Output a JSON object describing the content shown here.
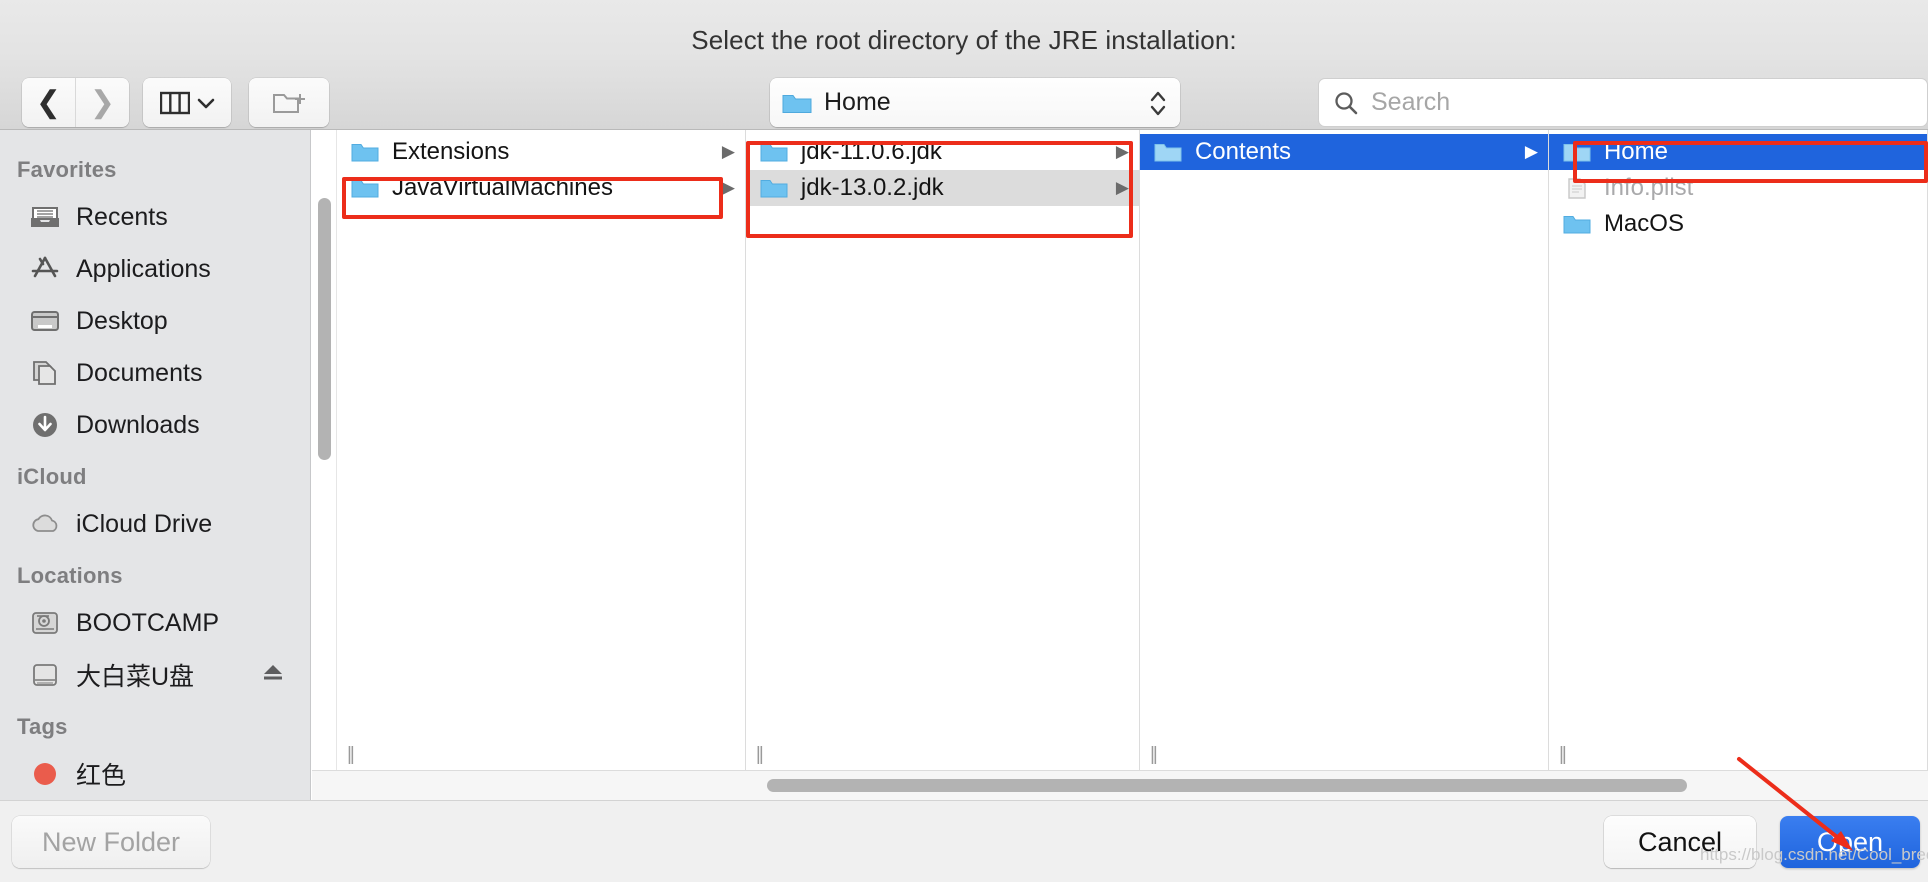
{
  "dialog": {
    "prompt": "Select the root directory of the JRE installation:"
  },
  "toolbar": {
    "back_icon": "chevron-left-icon",
    "forward_icon": "chevron-right-icon",
    "view_mode_icon": "column-view-icon",
    "view_mode_caret": "chevron-down-icon",
    "new_folder_icon": "new-folder-icon",
    "path_label": "Home",
    "path_folder_icon": "folder-icon",
    "stepper_up": "⌃",
    "stepper_down": "⌄"
  },
  "search": {
    "placeholder": "Search",
    "icon": "search-icon",
    "value": ""
  },
  "sidebar": {
    "sections": [
      {
        "header": "Favorites",
        "items": [
          {
            "label": "Recents",
            "icon": "recents-icon"
          },
          {
            "label": "Applications",
            "icon": "applications-icon"
          },
          {
            "label": "Desktop",
            "icon": "desktop-icon"
          },
          {
            "label": "Documents",
            "icon": "documents-icon"
          },
          {
            "label": "Downloads",
            "icon": "downloads-icon"
          }
        ]
      },
      {
        "header": "iCloud",
        "items": [
          {
            "label": "iCloud Drive",
            "icon": "icloud-drive-icon"
          }
        ]
      },
      {
        "header": "Locations",
        "items": [
          {
            "label": "BOOTCAMP",
            "icon": "hard-disk-icon"
          },
          {
            "label": "大白菜U盘",
            "icon": "external-drive-icon",
            "eject": "⏏"
          }
        ]
      },
      {
        "header": "Tags",
        "items": [
          {
            "label": "红色",
            "icon": "red-tag-icon"
          }
        ]
      }
    ]
  },
  "columns": [
    {
      "name": "column-1",
      "rows": [
        {
          "label": "Extensions",
          "icon": "folder-icon",
          "has_arrow": true,
          "state": "normal"
        },
        {
          "label": "JavaVirtualMachines",
          "icon": "folder-icon",
          "has_arrow": true,
          "state": "normal"
        }
      ]
    },
    {
      "name": "column-2",
      "rows": [
        {
          "label": "jdk-11.0.6.jdk",
          "icon": "folder-icon",
          "has_arrow": true,
          "state": "normal"
        },
        {
          "label": "jdk-13.0.2.jdk",
          "icon": "folder-icon",
          "has_arrow": true,
          "state": "selected-inactive"
        }
      ]
    },
    {
      "name": "column-3",
      "rows": [
        {
          "label": "Contents",
          "icon": "folder-icon",
          "has_arrow": true,
          "state": "selected"
        }
      ]
    },
    {
      "name": "column-4",
      "rows": [
        {
          "label": "Home",
          "icon": "folder-icon",
          "has_arrow": false,
          "state": "selected"
        },
        {
          "label": "Info.plist",
          "icon": "plist-file-icon",
          "has_arrow": false,
          "state": "disabled"
        },
        {
          "label": "MacOS",
          "icon": "folder-icon",
          "has_arrow": false,
          "state": "normal"
        }
      ]
    }
  ],
  "footer": {
    "new_folder_label": "New Folder",
    "cancel_label": "Cancel",
    "open_label": "Open"
  },
  "annotations": {
    "highlight_color": "#ec2d1a",
    "arrow": "pointer-arrow-to-open-button"
  },
  "watermark": "https://blog.csdn.net/Cool_breeze_bin",
  "colors": {
    "selection_blue": "#1f64dd",
    "selection_gray": "#dcdcdc",
    "sidebar_bg": "#e4e5e7",
    "titlebar_bg": "#e3e3e3",
    "folder_blue": "#6ec2f0"
  }
}
